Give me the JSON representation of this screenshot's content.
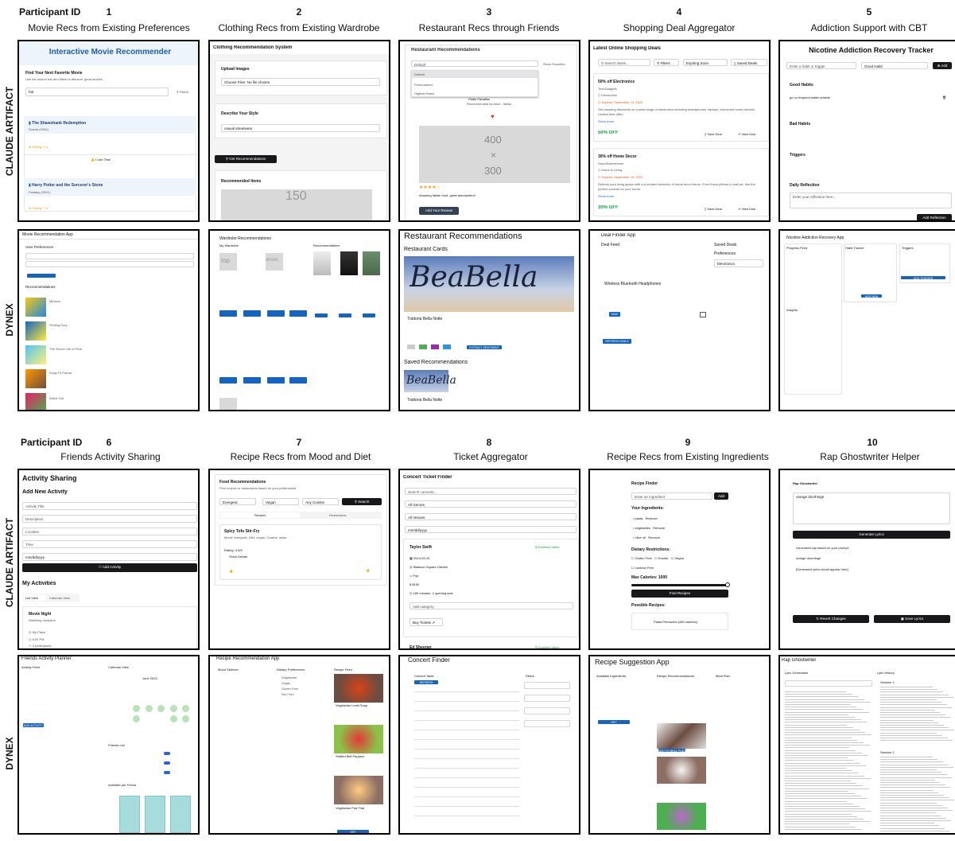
{
  "headers": {
    "participant_id": "Participant ID",
    "row_top": {
      "claude": "CLAUDE ARTIFACT",
      "dynex": "DYNEX"
    },
    "columns_top": [
      {
        "num": "1",
        "title": "Movie Recs from Existing Preferences"
      },
      {
        "num": "2",
        "title": "Clothing Recs from Existing Wardrobe"
      },
      {
        "num": "3",
        "title": "Restaurant Recs through Friends"
      },
      {
        "num": "4",
        "title": "Shopping Deal Aggregator"
      },
      {
        "num": "5",
        "title": "Addiction Support with CBT"
      }
    ],
    "columns_bottom": [
      {
        "num": "6",
        "title": "Friends Activity Sharing"
      },
      {
        "num": "7",
        "title": "Recipe Recs from Mood and Diet"
      },
      {
        "num": "8",
        "title": "Ticket Aggregator"
      },
      {
        "num": "9",
        "title": "Recipe Recs from Existing Ingredients"
      },
      {
        "num": "10",
        "title": "Rap Ghostwriter Helper"
      }
    ]
  },
  "p1c": {
    "title": "Interactive Movie Recommender",
    "find": "Find Your Next Favorite Movie",
    "hint": "Use the search bar and filters to discover great movies",
    "search": "hal",
    "filters": "Filters",
    "m1": "The Shawshank Redemption",
    "m1g": "Drama (1994)",
    "m1r": "Rating: 9.3",
    "like": "I Like This!",
    "m2": "Harry Potter and the Sorcerer's Stone",
    "m2g": "Fantasy (2001)",
    "m2r": "Rating: 7.6"
  },
  "p1d": {
    "title": "Movie Recommendation App",
    "prefs": "User Preferences",
    "recs": "Recommendations",
    "r1": "Minions",
    "r2": "Finding Dory",
    "r3": "The Secret Life of Pets",
    "r4": "Kung Fu Panda",
    "r5": "Inside Out"
  },
  "p2c": {
    "title": "Clothing Recommendation System",
    "upload": "Upload Images",
    "choose": "Choose Files",
    "nofile": "No file chosen",
    "describe": "Describe Your Style",
    "style": "casual streetwear",
    "get": "Get Recommendations",
    "recd": "Recommended Items",
    "ph": "150"
  },
  "p2d": {
    "title": "Wardrobe Recommendations",
    "my": "My Wardrobe",
    "recs": "Recommendations",
    "top": "top",
    "shoes": "shoes"
  },
  "p3c": {
    "title": "Restaurant Recommendations",
    "sel": "Default",
    "fav": "Show Favorites",
    "o1": "Default",
    "o2": "Personalized",
    "o3": "Highest Rated",
    "pname": "Piatto Paradiso",
    "pby": "Recommended by Alice - Italian",
    "ph1": "400",
    "ph2": "×",
    "ph3": "300",
    "review": "Amazing Italian food, great atmosphere!",
    "add": "Add Your Review"
  },
  "p3d": {
    "title": "Restaurant Recommendations",
    "cards": "Restaurant Cards",
    "logo": "BeaBella",
    "name": "Trattoria Bella Notte",
    "extract": "EXTRACT SENTIMENT",
    "saved": "Saved Recommendations",
    "name2": "Trattoria Bella Notte"
  },
  "p4c": {
    "title": "Latest Online Shopping Deals",
    "search": "Search deals...",
    "filters": "Filters",
    "expiring": "Expiring Soon",
    "saved": "Saved Deals",
    "d1": "50% off Electronics",
    "d1s": "TechGadgets",
    "d1c": "Electronics",
    "d1e": "Expires: September 14, 2024",
    "d1t": "Get amazing discounts on a wide range of electronics including smartphones, laptops, and smart home devices. Limited time offer!",
    "more": "Show more",
    "d1p": "50% OFF",
    "save": "Save Deal",
    "view": "View Deal",
    "d2": "30% off Home Decor",
    "d2s": "HomeSweetHome",
    "d2c": "Home & Living",
    "d2e": "Expires: September 19, 2024",
    "d2t": "Refresh your living space with our curated selection of home decor items. From throw pillows to wall art, find the perfect accents for your home.",
    "d2p": "30% OFF"
  },
  "p4d": {
    "title": "Deal Finder App",
    "feed": "Deal Feed",
    "saved": "Saved Deals",
    "prefs": "Preferences",
    "item": "Wireless Bluetooth Headphones",
    "pref": "Electronics",
    "refresh": "REFRESH DEALS",
    "save": "SAVE"
  },
  "p5c": {
    "title": "Nicotine Addiction Recovery Tracker",
    "habit": "Enter a habit or trigger",
    "type": "Good Habit",
    "add": "Add",
    "good": "Good Habits",
    "g1": "go on frequent walks outside",
    "bad": "Bad Habits",
    "triggers": "Triggers",
    "daily": "Daily Reflection",
    "ref": "Enter your reflection here...",
    "addref": "Add Reflection"
  },
  "p5d": {
    "title": "Nicotine Addiction Recovery App",
    "progress": "Progress Feed",
    "tracker": "Habit Tracker",
    "triggers": "Triggers",
    "insights": "Insights",
    "addnew": "ADD NEW",
    "add": "ADD TRIGGER"
  },
  "p6c": {
    "title": "Activity Sharing",
    "addnew": "Add New Activity",
    "f1": "Activity Title",
    "f2": "Description",
    "f3": "Location",
    "f4": "Time",
    "f5": "mm/dd/yyyy",
    "addbtn": "Add Activity",
    "my": "My Activities",
    "tab1": "List View",
    "tab2": "Calendar View",
    "a1": "Movie Night",
    "a1d": "Watching Inception",
    "a1l": "My Place",
    "a1t": "8:00 PM",
    "a1p": "3 participants"
  },
  "p6d": {
    "title": "Friends Activity Planner",
    "feed": "Activity Feed",
    "cal": "Calendar View",
    "month": "June 2023",
    "friends": "Friends List",
    "chart": "Activities per Friend",
    "add": "ADD ACTIVITY"
  },
  "p7c": {
    "title": "Food Recommendations",
    "hint": "Find recipes or restaurants based on your preferences",
    "s1": "Energetic",
    "s2": "Vegan",
    "s3": "Any Cuisine",
    "search": "Search",
    "t1": "Recipes",
    "t2": "Restaurants",
    "r1": "Spicy Tofu Stir-Fry",
    "r1m": "Mood: energetic, Diet: vegan, Cuisine: asian",
    "r1r": "Rating: 4.5/5",
    "details": "Show Details"
  },
  "p7d": {
    "title": "Recipe Recommendation App",
    "mood": "Mood Selector",
    "diet": "Dietary Preferences",
    "feed": "Recipe Feed",
    "d1": "Vegetarian",
    "d2": "Vegan",
    "d3": "Gluten Free",
    "d4": "Nut Free",
    "f1": "Vegetarian Lentil Soup",
    "f2": "Stuffed Bell Peppers",
    "f3": "Vegetarian Pad Thai",
    "get": "GET RECOMMENDATIONS"
  },
  "p8c": {
    "title": "Concert Ticket Finder",
    "search": "Search concerts...",
    "genres": "All Genres",
    "venues": "All Venues",
    "date": "mm/dd/yyyy",
    "artist": "Taylor Swift",
    "value": "Excellent Value",
    "d": "2024-09-15",
    "venue": "Madison Square Garden",
    "genre": "Pop",
    "price": "$150",
    "dur": "180 minutes, 2 opening acts",
    "cat": "Add category",
    "buy": "Buy Tickets",
    "artist2": "Ed Sheeran",
    "value2": "Excellent Value"
  },
  "p8d": {
    "title": "Concert Finder",
    "table": "Concert Table",
    "filters": "Filters",
    "refresh": "REFRESH CONCERTS"
  },
  "p9c": {
    "title": "Recipe Finder",
    "enter": "Enter an ingredient",
    "add": "Add",
    "yours": "Your Ingredients:",
    "i1": "pasta",
    "i2": "vegetables",
    "i3": "olive oil",
    "remove": "Remove",
    "diet": "Dietary Restrictions:",
    "c1": "Gluten Free",
    "c2": "Kosher",
    "c3": "Vegan",
    "c4": "Lactose Free",
    "cal": "Max Calories: 1000",
    "find": "Find Recipes",
    "possible": "Possible Recipes:",
    "recipe": "Pasta Primavera (450 calories)"
  },
  "p9d": {
    "title": "Recipe Suggestion App",
    "avail": "Available Ingredients",
    "recs": "Recipe Recommendations",
    "plan": "Meal Plan",
    "get": "GET RECOMMENDATIONS",
    "add": "ADD TO MEAL PLAN"
  },
  "p10c": {
    "title": "Rap Ghostwriter",
    "input": "orange doorhinge",
    "gen": "Generate Lyrics",
    "based": "Generated rap based on your prompt:",
    "prompt": "orange doorhinge",
    "placeholder": "[Generated lyrics would appear here]",
    "revert": "Revert Changes",
    "save": "Save Lyrics"
  },
  "p10d": {
    "title": "Rap Ghostwriter",
    "gen": "Lyric Generation",
    "hist": "Lyric History",
    "s1": "Session 1",
    "s2": "Session 2"
  }
}
